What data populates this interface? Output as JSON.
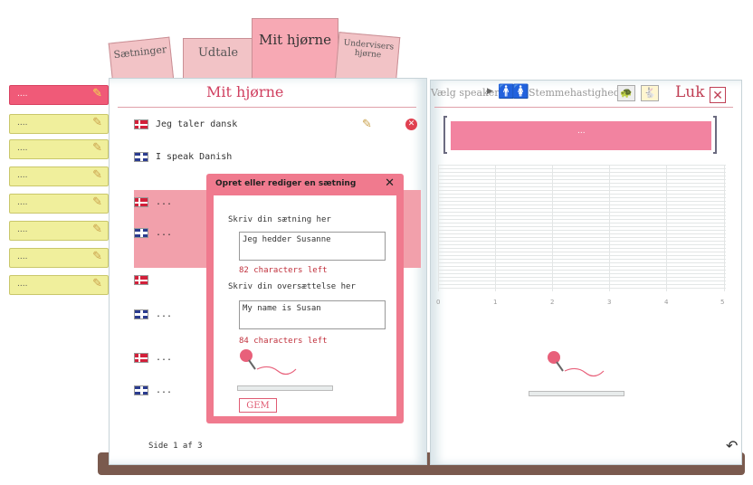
{
  "tabs": [
    {
      "label": "Sætninger"
    },
    {
      "label": "Udtale"
    },
    {
      "label": "Mit hjørne"
    },
    {
      "label_line1": "Undervisers",
      "label_line2": "hjørne"
    }
  ],
  "sidebar": {
    "notes": [
      {
        "label": "...."
      },
      {
        "label": "...."
      },
      {
        "label": "...."
      },
      {
        "label": "...."
      },
      {
        "label": "...."
      },
      {
        "label": "...."
      },
      {
        "label": "...."
      },
      {
        "label": "...."
      }
    ]
  },
  "left_page": {
    "title": "Mit hjørne",
    "rows": [
      {
        "lang": "dk",
        "text": "Jeg taler dansk"
      },
      {
        "lang": "uk",
        "text": "I speak Danish"
      },
      {
        "lang": "dk",
        "text": "..."
      },
      {
        "lang": "uk",
        "text": "..."
      },
      {
        "lang": "dk",
        "text": ""
      },
      {
        "lang": "uk",
        "text": "..."
      },
      {
        "lang": "dk",
        "text": "..."
      },
      {
        "lang": "uk",
        "text": "..."
      }
    ],
    "pagination": "Side 1 af 3"
  },
  "modal": {
    "title": "Opret eller rediger en sætning",
    "close": "✕",
    "sentence_label": "Skriv din sætning her",
    "sentence_value": "Jeg hedder Susanne",
    "sentence_count": "82 characters left",
    "translation_label": "Skriv din oversættelse her",
    "translation_value": "My name is Susan",
    "translation_count": "84 characters left",
    "save_label": "GEM"
  },
  "right_page": {
    "speaker_label": "Vælg speaker",
    "speed_label": "Stemmehastighed:",
    "close_label": "Luk",
    "bar_text": "...",
    "x_ticks": [
      "0",
      "1",
      "2",
      "3",
      "4",
      "5"
    ]
  },
  "colors": {
    "accent": "#f07a8e",
    "tab": "#f2c3c6",
    "note": "#f0ef9c"
  }
}
